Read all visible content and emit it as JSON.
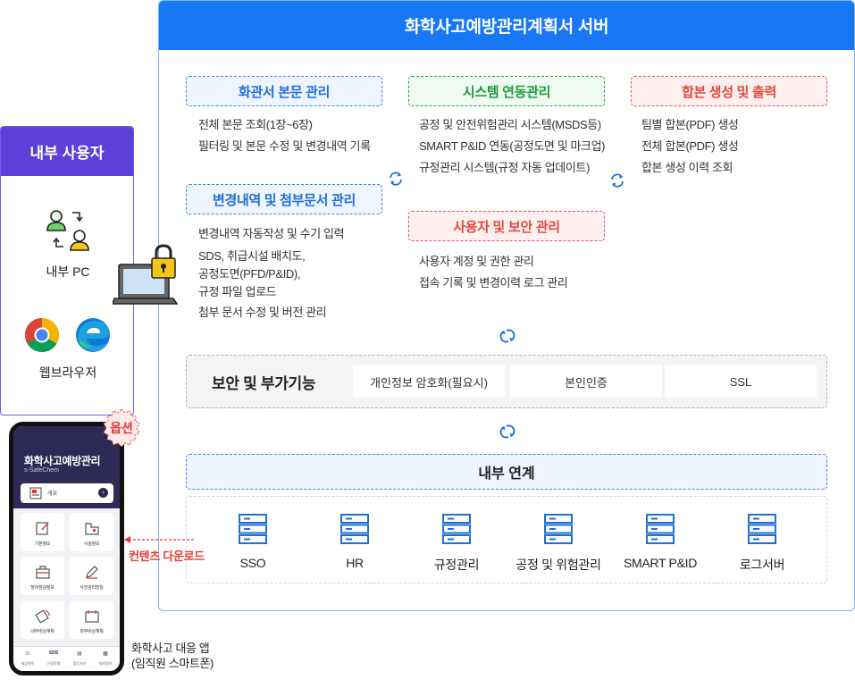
{
  "server": {
    "title": "화학사고예방관리계획서 서버",
    "modules": {
      "document": {
        "title": "화관서 본문 관리",
        "items": [
          "전체 본문 조회(1장~6장)",
          "필터링 및 본문 수정 및 변경내역 기록"
        ]
      },
      "system": {
        "title": "시스템 연동관리",
        "items": [
          "공정 및 안전위험관리 시스템(MSDS등)",
          "SMART P&ID 연동(공정도면 및 마크업)",
          "규정관리 시스템(규정 자동 업데이트)"
        ]
      },
      "output": {
        "title": "합본 생성 및 출력",
        "items": [
          "팀별 합본(PDF) 생성",
          "전체 합본(PDF) 생성",
          "합본 생성 이력 조회"
        ]
      },
      "changes": {
        "title": "변경내역 및 첨부문서 관리",
        "items": [
          "변경내역 자동작성 및 수기 입력",
          "SDS, 취급시설 배치도,",
          "공정도면(PFD/P&ID),",
          "규정 파일 업로드",
          "첨부 문서 수정 및 버전 관리"
        ]
      },
      "security_mgmt": {
        "title": "사용자 및 보안 관리",
        "items": [
          "사용자 계정 및 권한 관리",
          "접속 기록 및 변경이력 로그 관리"
        ]
      }
    },
    "security": {
      "title": "보안 및 부가기능",
      "features": [
        "개인정보 암호화(필요시)",
        "본인인증",
        "SSL"
      ]
    },
    "internal": {
      "title": "내부 연계",
      "systems": [
        "SSO",
        "HR",
        "규정관리",
        "공정 및 위험관리",
        "SMART P&ID",
        "로그서버"
      ]
    }
  },
  "internal_user": {
    "title": "내부 사용자",
    "pc_label": "내부 PC",
    "browser_label": "웹브라우저"
  },
  "mobile": {
    "option_badge": "옵션",
    "download_label": "컨텐츠 다운로드",
    "caption_line1": "화학사고 대응 앱",
    "caption_line2": "(임직원 스마트폰)",
    "app_title": "화학사고예방관리",
    "app_subtitle": "s-SafeChem",
    "overview_label": "개요",
    "tiles": [
      "기본정보",
      "시설정보",
      "장비점검정보",
      "사전관리방침",
      "내부비상계획",
      "외부비상계획"
    ],
    "nav": [
      "비상연락",
      "규정로컬",
      "업무처리",
      "대피정보"
    ],
    "nav_icon_sds": "SDS"
  },
  "colors": {
    "server_header": "#1877f2",
    "user_header": "#5b3fd8",
    "blue_title": "#1f6fd6",
    "green_title": "#1d9a3e",
    "red_title": "#e5483d"
  }
}
